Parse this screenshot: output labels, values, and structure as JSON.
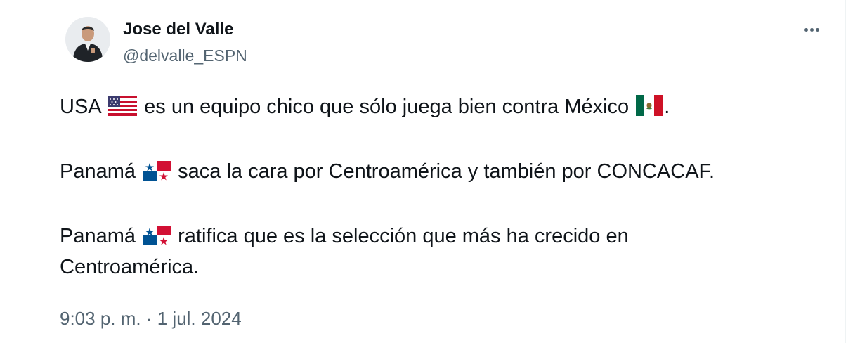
{
  "tweet": {
    "author_name": "Jose del Valle",
    "handle": "@delvalle_ESPN",
    "more_icon": "more-horizontal-icon",
    "lines": {
      "l1a": "USA",
      "l1b": "es un equipo chico que sólo juega bien contra México",
      "l1c": ".",
      "l2a": "Panamá",
      "l2b": "saca la cara por Centroamérica y también por CONCACAF.",
      "l3a": "Panamá",
      "l3b": "ratifica que es la selección que más ha crecido en",
      "l3c": "Centroamérica."
    },
    "flags": {
      "usa": "us-flag-icon",
      "mexico": "mexico-flag-icon",
      "panama": "panama-flag-icon"
    },
    "time": "9:03 p. m.",
    "separator": " · ",
    "date": "1 jul. 2024"
  }
}
